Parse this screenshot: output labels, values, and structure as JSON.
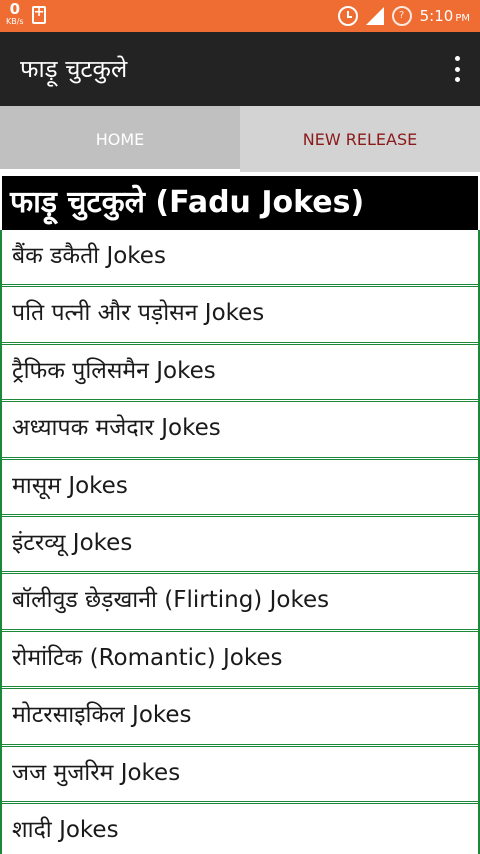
{
  "status_bar": {
    "net_speed": "0",
    "net_unit": "KB/s",
    "time": "5:10",
    "ampm": "PM",
    "background": "#ef6c32",
    "icons": [
      "battery-plus-icon",
      "alarm-clock-icon",
      "signal-icon",
      "sim-icon"
    ]
  },
  "app_bar": {
    "title": "फाड़ू चुटकुले",
    "menu_icon": "overflow-menu-icon"
  },
  "tabs": [
    {
      "label": "HOME",
      "selected": true
    },
    {
      "label": "NEW RELEASE",
      "selected": false
    }
  ],
  "list": {
    "header": "फाड़ू चुटकुले (Fadu Jokes)",
    "items": [
      "बैंक डकैती Jokes",
      "पति पत्नी और पड़ोसन Jokes",
      "ट्रैफिक पुलिसमैन Jokes",
      "अध्यापक मजेदार Jokes",
      "मासूम Jokes",
      "इंटरव्यू Jokes",
      "बॉलीवुड छेड़खानी (Flirting) Jokes",
      "रोमांटिक (Romantic) Jokes",
      "मोटरसाइकिल Jokes",
      "जज मुजरिम Jokes",
      "शादी Jokes"
    ],
    "border_color": "#1a8a3a"
  }
}
